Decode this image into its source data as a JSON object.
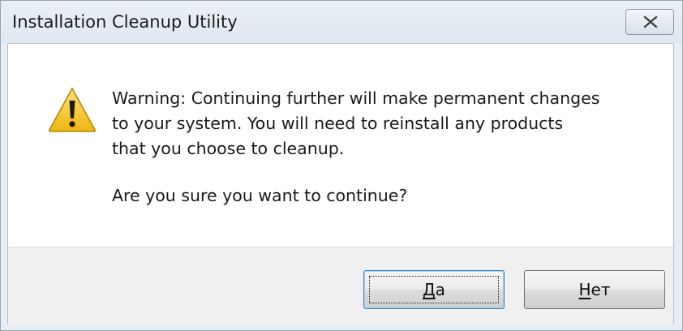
{
  "window": {
    "title": "Installation Cleanup Utility"
  },
  "icons": {
    "warning": "warning-icon",
    "close": "close-icon"
  },
  "message": {
    "lines": [
      "Warning: Continuing further will make permanent changes",
      "to your system. You will need to reinstall any products",
      "that you choose to cleanup."
    ],
    "question": "Are you sure you want to continue?"
  },
  "buttons": {
    "yes_mnemonic": "Д",
    "yes_rest": "а",
    "no_mnemonic": "Н",
    "no_rest": "ет"
  },
  "colors": {
    "warning_fill": "#f2c21b",
    "focus_border": "#3c7fb1"
  }
}
